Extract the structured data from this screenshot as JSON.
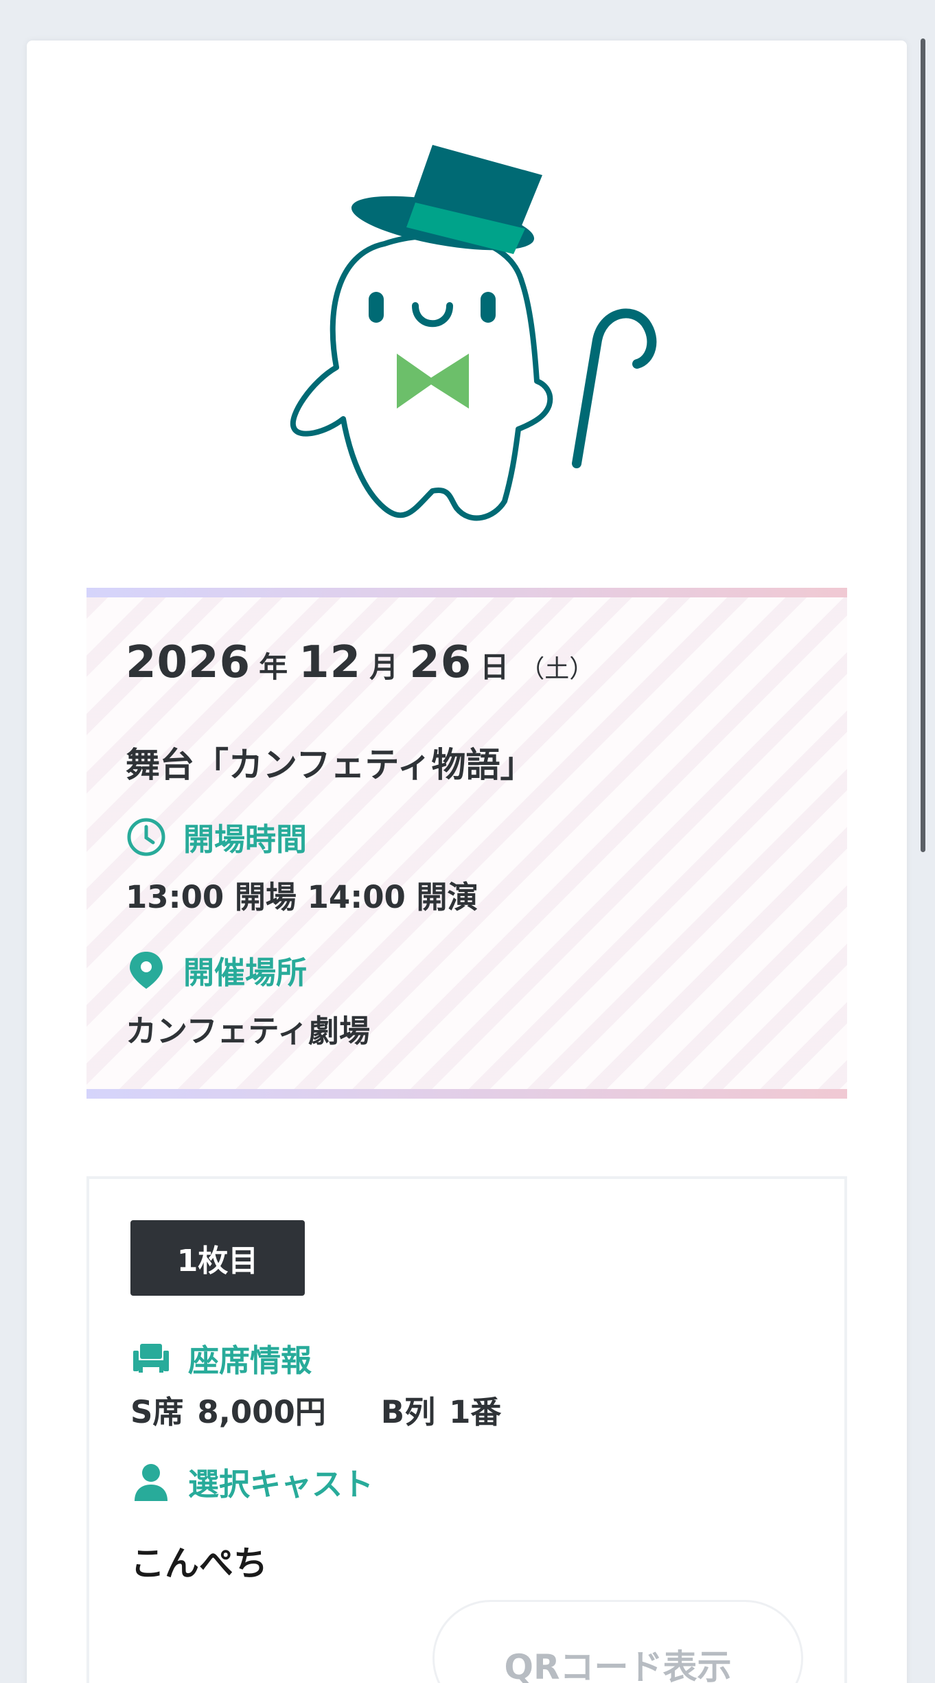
{
  "event": {
    "year": "2026",
    "year_unit": "年",
    "month": "12",
    "month_unit": "月",
    "day": "26",
    "day_unit": "日",
    "weekday": "（土）",
    "title": "舞台「カンフェティ物語」",
    "time_label": "開場時間",
    "time_value": "13:00 開場  14:00 開演",
    "venue_label": "開催場所",
    "venue_value": "カンフェティ劇場"
  },
  "ticket": {
    "badge": "1枚目",
    "seat_label": "座席情報",
    "seat_class": "S席",
    "seat_price": "8,000円",
    "seat_row": "B列",
    "seat_number": "1番",
    "cast_label": "選択キャスト",
    "cast_name": "こんぺち",
    "qr_button": "QRコード表示"
  },
  "icons": {
    "time": "clock-icon",
    "venue": "map-pin-icon",
    "seat": "seat-icon",
    "cast": "person-icon"
  },
  "colors": {
    "accent": "#28ab9a",
    "badge_bg": "#2f3338",
    "mascot_dark": "#006a74",
    "mascot_band": "#00a38a",
    "mascot_bow": "#6cbf6a"
  }
}
